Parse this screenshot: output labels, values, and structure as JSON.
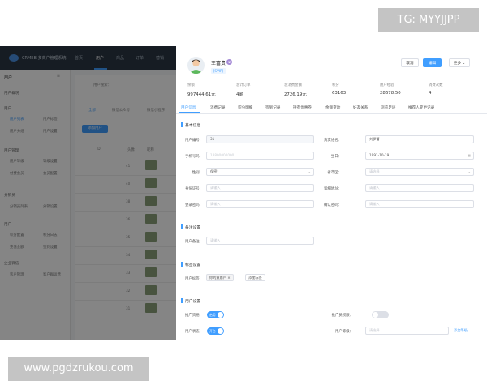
{
  "watermark": {
    "top": "TG: MYYJJPP",
    "bottom": "www.pgdzrukou.com"
  },
  "topbar": {
    "app_title": "CRMEB 多商户管理系统",
    "nav": [
      "首页",
      "用户",
      "商品",
      "订单",
      "营销"
    ]
  },
  "sidebar": {
    "header": "用户",
    "groups": [
      {
        "label": "用户概况",
        "items": []
      },
      {
        "label": "用户",
        "items": [
          "用户列表",
          "用户标签",
          "用户分组",
          "用户设置"
        ]
      },
      {
        "label": "用户管理",
        "items": [
          "用户等级",
          "等级设置",
          "付费会员",
          "会员配置"
        ]
      },
      {
        "label": "分销员",
        "items": [
          "分销员列表",
          "分销设置"
        ]
      },
      {
        "label": "用户",
        "items": [
          "积分配置",
          "积分日志",
          "充值金额",
          "签到设置"
        ]
      },
      {
        "label": "企业微信",
        "items": [
          "客户管理",
          "客户群运营"
        ]
      }
    ]
  },
  "background": {
    "search_label": "用户搜索：",
    "tabs": [
      "全部",
      "微信公众号",
      "微信小程序"
    ],
    "btn": "添加用户",
    "col_headers": [
      "ID",
      "头像",
      "昵称"
    ],
    "rows": [
      "41",
      "40",
      "38",
      "36",
      "35",
      "34",
      "33",
      "32",
      "31"
    ]
  },
  "drawer": {
    "user": {
      "name": "王富贵",
      "tag": "[SVIP]"
    },
    "buttons": {
      "cancel": "取消",
      "edit": "编辑",
      "more": "更多"
    },
    "stats": [
      {
        "label": "余额",
        "value": "997444.61元"
      },
      {
        "label": "总计订单",
        "value": "4笔"
      },
      {
        "label": "总消费金额",
        "value": "2726.19元"
      },
      {
        "label": "积分",
        "value": "63163"
      },
      {
        "label": "用户经验",
        "value": "28678.50"
      },
      {
        "label": "消费次数",
        "value": "4"
      }
    ],
    "tabs": [
      "用户信息",
      "消费记录",
      "积分明细",
      "签到记录",
      "持有优惠券",
      "余额变动",
      "好友关系",
      "浏览足迹",
      "推荐人变更记录"
    ],
    "sections": {
      "basic": "基本信息",
      "remark": "备注设置",
      "label": "标签设置",
      "user": "用户设置"
    },
    "basic_fields": {
      "uid": {
        "label": "用户编号：",
        "value": "31"
      },
      "real_name": {
        "label": "真实姓名：",
        "value": "刘伊蕾"
      },
      "phone": {
        "label": "手机号码：",
        "value": "18800000000"
      },
      "birthday": {
        "label": "生日：",
        "value": "1991-10-19"
      },
      "gender": {
        "label": "性别：",
        "value": "保密"
      },
      "region": {
        "label": "省市区：",
        "placeholder": "请选择"
      },
      "id_card": {
        "label": "身份证号：",
        "placeholder": "请输入"
      },
      "address": {
        "label": "详细地址：",
        "placeholder": "请输入"
      },
      "password": {
        "label": "登录密码：",
        "placeholder": "请输入"
      },
      "confirm_pwd": {
        "label": "确认密码：",
        "placeholder": "请输入"
      }
    },
    "remark": {
      "label": "用户备注：",
      "placeholder": "请输入"
    },
    "tags": {
      "label": "用户标签：",
      "chips": [
        "你的意愿户"
      ],
      "add": "添加标签"
    },
    "user_settings": {
      "promoter": {
        "label": "推广资格：",
        "state": "启用"
      },
      "paid_member": {
        "label": "推广员权限：",
        "state": ""
      },
      "status": {
        "label": "用户状态：",
        "state": "开启"
      },
      "level": {
        "label": "用户等级：",
        "placeholder": "请选择"
      },
      "add_level_link": "添加等级"
    }
  },
  "colors": {
    "accent": "#409eff",
    "topbar": "#2b3744"
  }
}
